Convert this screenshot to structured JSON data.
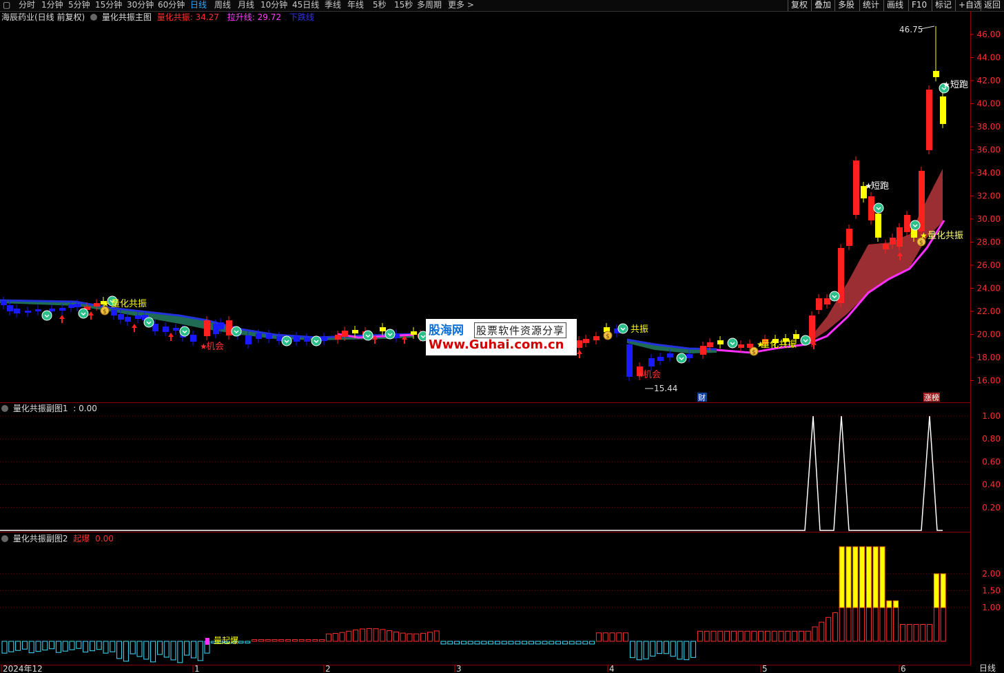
{
  "toolbar": {
    "menu_icon": "▢",
    "periods": [
      "分时",
      "1分钟",
      "5分钟",
      "15分钟",
      "30分钟",
      "60分钟",
      "日线",
      "周线",
      "月线",
      "10分钟",
      "45日线",
      "季线",
      "年线",
      "5秒",
      "15秒",
      "多周期",
      "更多 >"
    ],
    "active_period": "日线",
    "right_buttons": [
      "复权",
      "叠加",
      "多股",
      "统计",
      "画线",
      "F10",
      "标记",
      "+自选",
      "返回"
    ]
  },
  "main_panel": {
    "title": "海辰药业(日线 前复权)",
    "indicator_name": "量化共振主图",
    "legend": [
      {
        "label": "量化共振:",
        "value": "34.27",
        "color": "#ff3030"
      },
      {
        "label": "拉升线:",
        "value": "29.72",
        "color": "#ff40ff"
      },
      {
        "label": "下跌线",
        "value": "",
        "color": "#3030ff"
      }
    ],
    "y_ticks": [
      "46.00",
      "44.00",
      "42.00",
      "40.00",
      "38.00",
      "36.00",
      "34.00",
      "32.00",
      "30.00",
      "28.00",
      "26.00",
      "24.00",
      "22.00",
      "20.00",
      "18.00",
      "16.00"
    ],
    "annotations": {
      "high": "46.75",
      "low": "15.44",
      "gongzhen": "量化共振",
      "gongzhen_partial": "共振",
      "duanpao": "短跑",
      "jihui": "机会",
      "cai": "财",
      "zhangting": "涨榜"
    }
  },
  "sub1": {
    "title": "量化共振副图1",
    "value": ": 0.00",
    "y_ticks": [
      "1.00",
      "0.80",
      "0.60",
      "0.40",
      "0.20"
    ]
  },
  "sub2": {
    "title": "量化共振副图2",
    "label": "起爆",
    "value": "0.00",
    "y_ticks": [
      "2.00",
      "1.50",
      "1.00"
    ],
    "annotation": "量起爆"
  },
  "x_axis": {
    "labels": [
      "2024年12",
      "1",
      "2",
      "3",
      "4",
      "5",
      "6"
    ],
    "period_label": "日线"
  },
  "watermark": {
    "line1": "股海网",
    "line1b": "股票软件资源分享",
    "line2": "Www.Guhai.com.cn"
  },
  "colors": {
    "up": "#ff2020",
    "down": "#1a1aff",
    "yellow": "#ffff00",
    "magenta": "#ff30ff",
    "cyan": "#40e0ff",
    "grid": "#8b0000"
  }
}
